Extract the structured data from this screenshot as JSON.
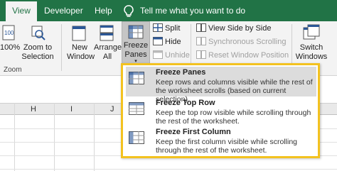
{
  "tabs": {
    "view": "View",
    "developer": "Developer",
    "help": "Help",
    "tell_me": "Tell me what you want to do"
  },
  "ribbon": {
    "zoom_100": "100%",
    "zoom_to_selection_1": "Zoom to",
    "zoom_to_selection_2": "Selection",
    "zoom_group": "Zoom",
    "new_window_1": "New",
    "new_window_2": "Window",
    "arrange_all_1": "Arrange",
    "arrange_all_2": "All",
    "freeze_panes_1": "Freeze",
    "freeze_panes_2": "Panes",
    "split": "Split",
    "hide": "Hide",
    "unhide": "Unhide",
    "view_side_by_side": "View Side by Side",
    "synchronous_scrolling": "Synchronous Scrolling",
    "reset_window_position": "Reset Window Position",
    "switch_windows_1": "Switch",
    "switch_windows_2": "Windows"
  },
  "sheet": {
    "columns": [
      "H",
      "I",
      "J"
    ]
  },
  "dropdown": {
    "items": [
      {
        "title": "Freeze Panes",
        "title_underline": "F",
        "description": "Keep rows and columns visible while the rest of the worksheet scrolls (based on current selection)."
      },
      {
        "title": "Freeze Top Row",
        "title_underline": "R",
        "description": "Keep the top row visible while scrolling through the rest of the worksheet."
      },
      {
        "title": "Freeze First Column",
        "title_underline": "C",
        "description": "Keep the first column visible while scrolling through the rest of the worksheet."
      }
    ]
  },
  "colors": {
    "tab_bar": "#217346",
    "ribbon_bg": "#f3f3f3",
    "highlight_border": "#f3c220",
    "pressed_button": "#c5c5c5"
  }
}
